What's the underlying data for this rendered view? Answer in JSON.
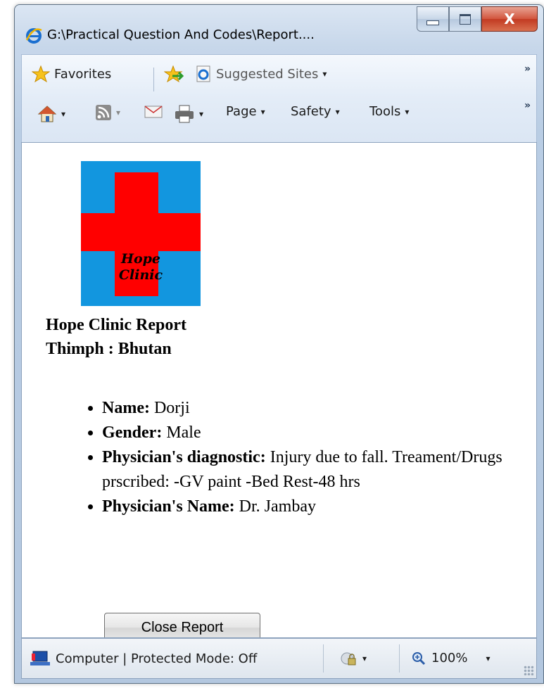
{
  "window": {
    "title": "G:\\Practical Question And Codes\\Report....",
    "controls": {
      "minimize_icon": "minimize-icon",
      "maximize_icon": "maximize-icon",
      "close_glyph": "X"
    }
  },
  "favorites_bar": {
    "favorites_label": "Favorites",
    "suggested_sites_label": "Suggested Sites",
    "dropdown_glyph": "▾",
    "overflow_glyph": "»"
  },
  "command_bar": {
    "page_label": "Page",
    "safety_label": "Safety",
    "tools_label": "Tools",
    "dropdown_glyph": "▾",
    "overflow_glyph": "»"
  },
  "report": {
    "logo_text_line1": "Hope",
    "logo_text_line2": "Clinic",
    "heading_line1": "Hope Clinic Report",
    "heading_line2": "Thimph : Bhutan",
    "fields": [
      {
        "label": "Name:",
        "value": " Dorji"
      },
      {
        "label": "Gender:",
        "value": " Male"
      },
      {
        "label": "Physician's diagnostic:",
        "value": " Injury due to fall. Treament/Drugs prscribed: -GV paint -Bed Rest-48 hrs"
      },
      {
        "label": "Physician's Name:",
        "value": " Dr. Jambay"
      }
    ],
    "close_button_label": "Close Report"
  },
  "status_bar": {
    "zone_text": "Computer | Protected Mode: Off",
    "zoom_text": "100%",
    "dropdown_glyph": "▾"
  },
  "colors": {
    "logo_background": "#1296df",
    "logo_cross": "#ff0000",
    "close_button_red": "#c23a22"
  }
}
